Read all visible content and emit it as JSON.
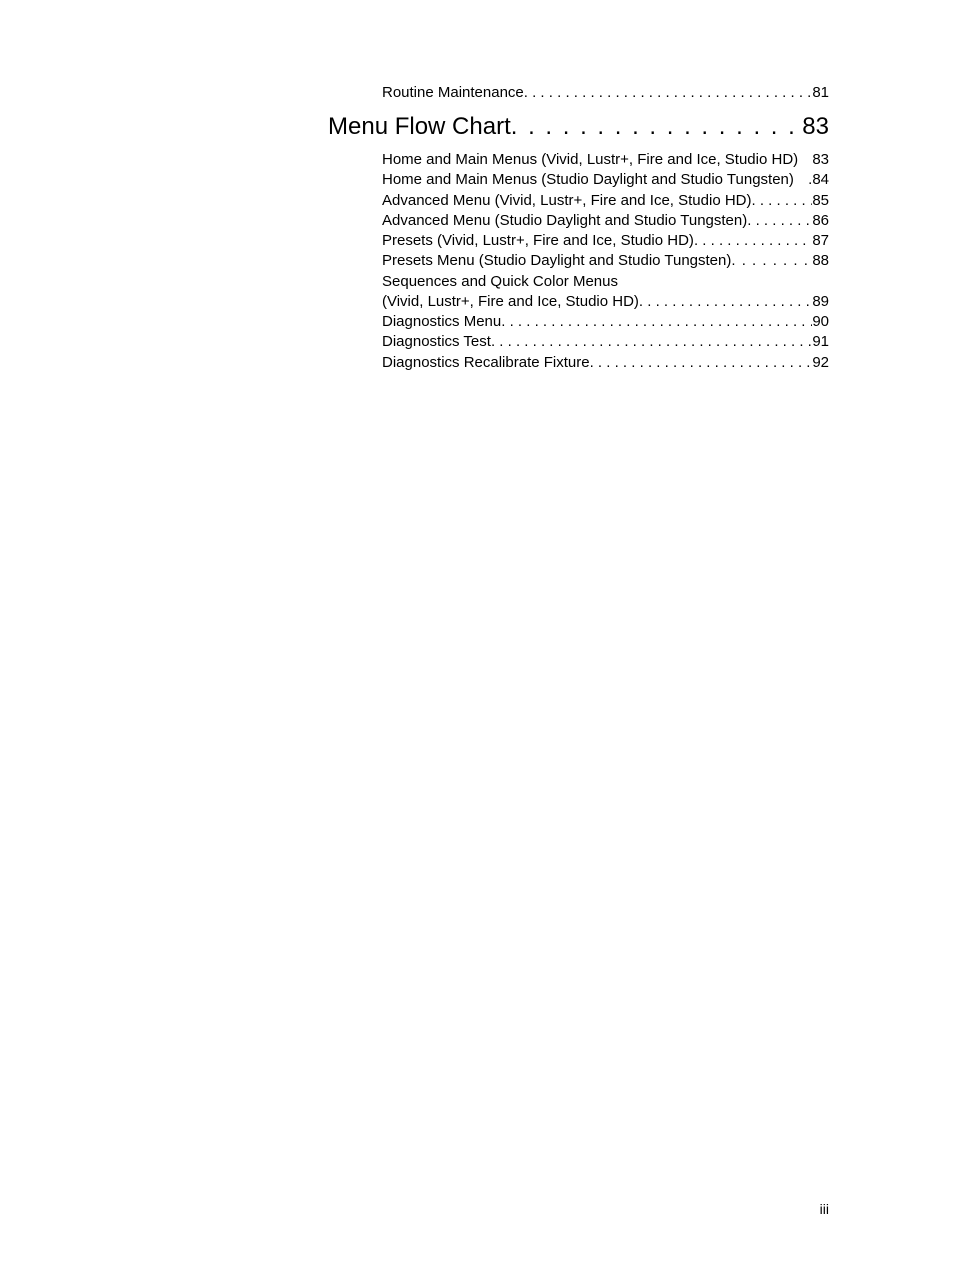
{
  "toc": {
    "pre_section": {
      "label": "Routine Maintenance",
      "page": "81"
    },
    "chapter": {
      "label": "Menu Flow Chart",
      "page": "83"
    },
    "sub": [
      {
        "label": "Home and Main Menus (Vivid, Lustr+, Fire and Ice, Studio HD)",
        "page": "83",
        "style": "space"
      },
      {
        "label": "Home and Main Menus (Studio Daylight and Studio Tungsten)",
        "page": "84",
        "style": "space_dot"
      },
      {
        "label": "Advanced Menu (Vivid, Lustr+, Fire and Ice, Studio HD)",
        "page": "85",
        "style": "dots"
      },
      {
        "label": "Advanced Menu (Studio Daylight and Studio Tungsten)",
        "page": "86",
        "style": "dots"
      },
      {
        "label": "Presets (Vivid, Lustr+, Fire and Ice, Studio HD)",
        "page": "87",
        "style": "dots"
      },
      {
        "label": "Presets Menu (Studio Daylight and Studio Tungsten)",
        "page": "88",
        "style": "dots_spaced"
      }
    ],
    "wrap_entry": {
      "line1": "Sequences and Quick Color Menus",
      "line2_label": "(Vivid, Lustr+, Fire and Ice, Studio HD)",
      "page": "89"
    },
    "sub_after": [
      {
        "label": "Diagnostics Menu",
        "page": "90"
      },
      {
        "label": "Diagnostics Test",
        "page": "91"
      },
      {
        "label": "Diagnostics Recalibrate Fixture",
        "page": "92"
      }
    ]
  },
  "page_number": "iii"
}
